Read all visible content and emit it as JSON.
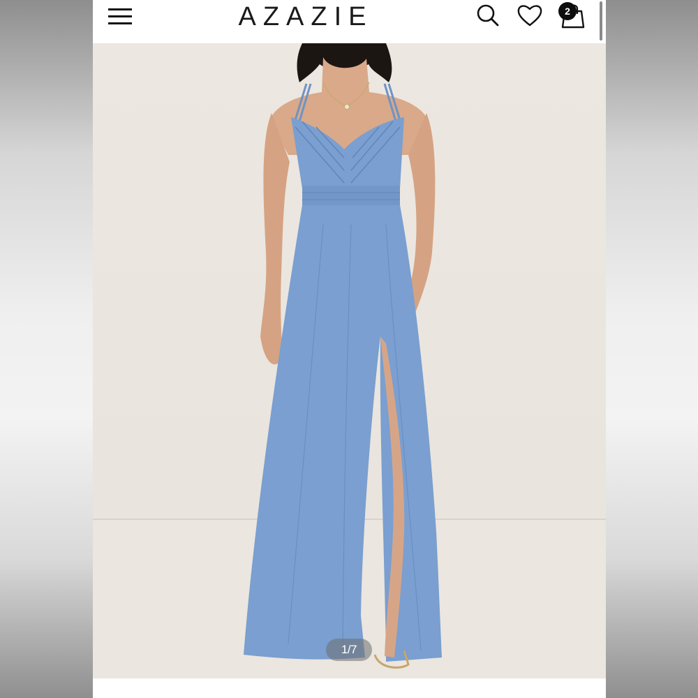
{
  "header": {
    "brand": "AZAZIE",
    "cart_count": "2",
    "icons": [
      "menu-icon",
      "search-icon",
      "heart-icon",
      "shopping-bag-icon"
    ]
  },
  "gallery": {
    "counter": "1/7"
  },
  "colors": {
    "dress": "#7a9fd0",
    "backdrop": "#ebe6e0",
    "header_bg": "#ffffff",
    "badge_bg": "#0d0d0d"
  }
}
